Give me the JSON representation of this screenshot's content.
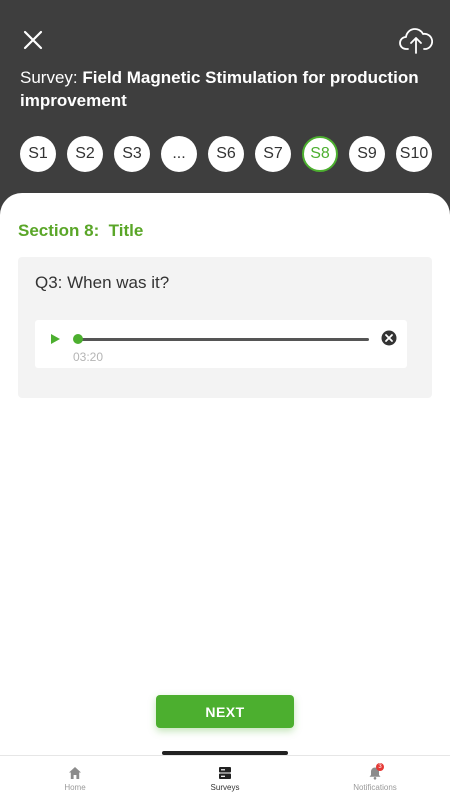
{
  "header": {
    "title_prefix": "Survey:",
    "survey_name": "Field Magnetic Stimulation for production improvement",
    "close_icon": "close-icon",
    "upload_icon": "cloud-upload-icon"
  },
  "sections": {
    "items": [
      "S1",
      "S2",
      "S3",
      "...",
      "S6",
      "S7",
      "S8",
      "S9",
      "S10"
    ],
    "active": "S8"
  },
  "section": {
    "heading": "Section 8:  Title"
  },
  "question": {
    "text": "Q3: When was it?",
    "audio": {
      "time": "03:20",
      "progress": 0.0
    }
  },
  "actions": {
    "next_label": "NEXT"
  },
  "nav": {
    "home_label": "Home",
    "surveys_label": "Surveys",
    "notifications_label": "Notifications",
    "notifications_badge": "3",
    "active": "Surveys"
  },
  "colors": {
    "accent": "#4caf2f",
    "header_bg": "#3e3e3e"
  }
}
